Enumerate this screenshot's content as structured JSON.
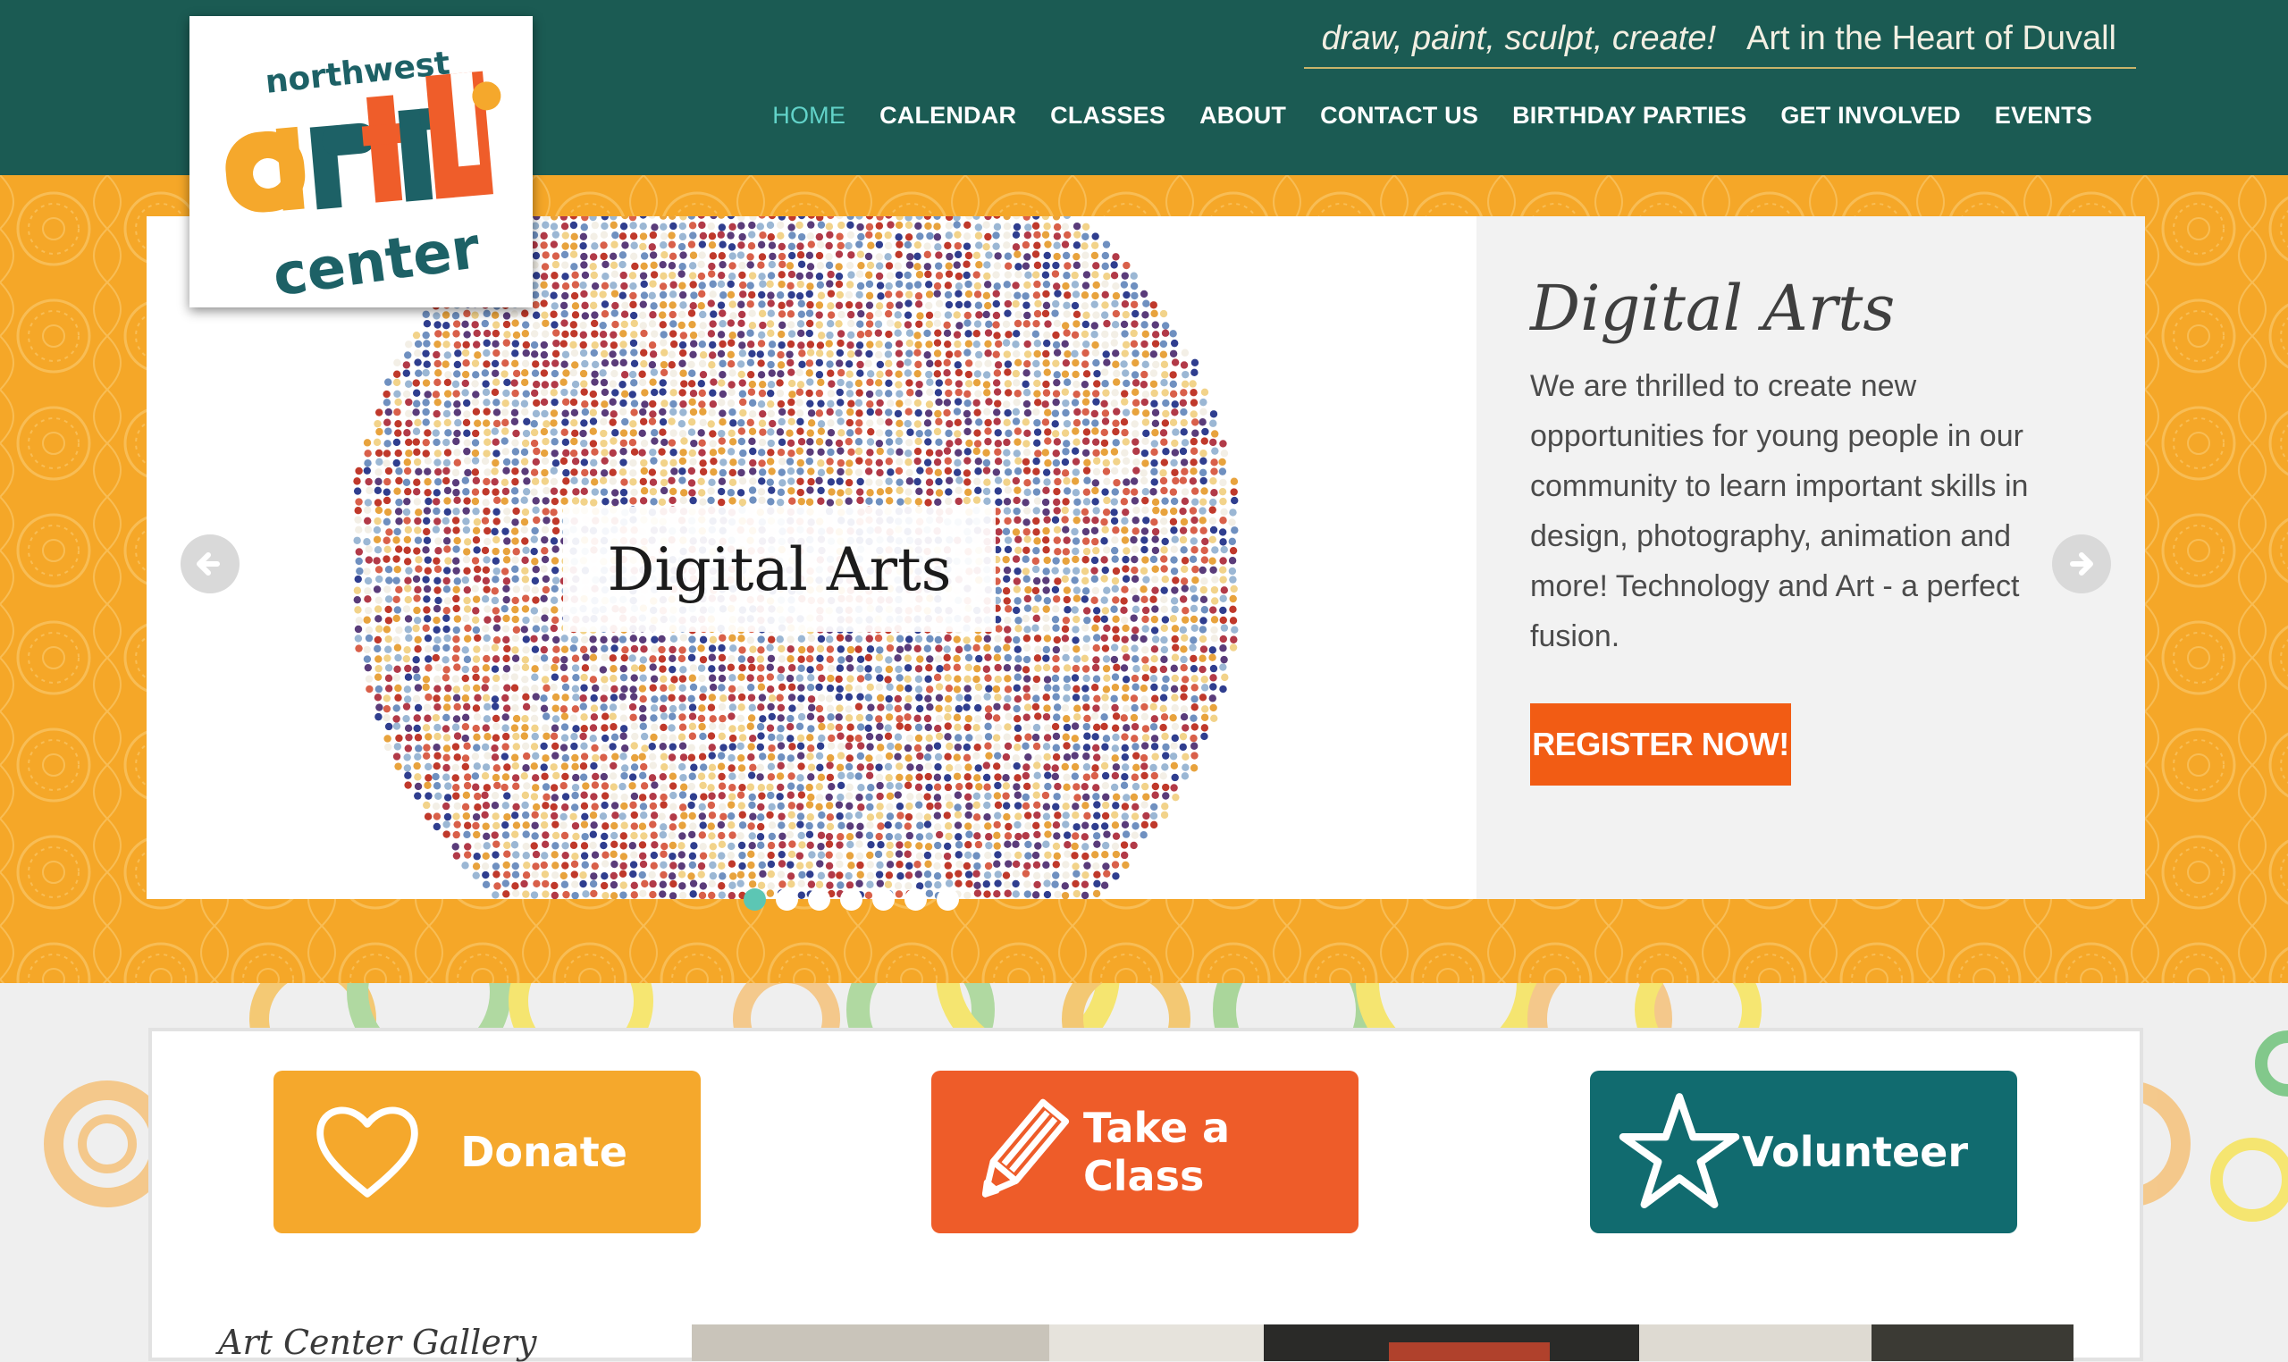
{
  "header": {
    "tagline_italic": "draw, paint, sculpt, create!",
    "tagline_main": "Art in the Heart of Duvall",
    "bg_color": "#1b5b53"
  },
  "logo": {
    "line1": "northwest",
    "line2": "art",
    "line3": "center"
  },
  "nav": [
    {
      "label": "HOME",
      "active": true
    },
    {
      "label": "CALENDAR"
    },
    {
      "label": "CLASSES"
    },
    {
      "label": "ABOUT"
    },
    {
      "label": "CONTACT US"
    },
    {
      "label": "BIRTHDAY PARTIES"
    },
    {
      "label": "GET INVOLVED"
    },
    {
      "label": "EVENTS"
    }
  ],
  "slider": {
    "image_caption": "Digital Arts",
    "title": "Digital Arts",
    "body": "We are thrilled to create new opportunities for young people in our community to learn important skills in design, photography, animation and more! Technology and Art - a perfect fusion.",
    "button": "REGISTER NOW!",
    "dots_total": 7,
    "active_dot": 1,
    "prev_icon": "arrow-left-icon",
    "next_icon": "arrow-right-icon"
  },
  "cta": {
    "donate": "Donate",
    "take_class": "Take a Class",
    "volunteer": "Volunteer"
  },
  "gallery": {
    "title": "Art Center Gallery"
  },
  "colors": {
    "orange_band": "#f5a728",
    "register_button": "#f25c14",
    "active_nav": "#62d3c9",
    "donate": "#f5a82c",
    "take_class": "#ee5c29",
    "volunteer": "#116b6f"
  }
}
